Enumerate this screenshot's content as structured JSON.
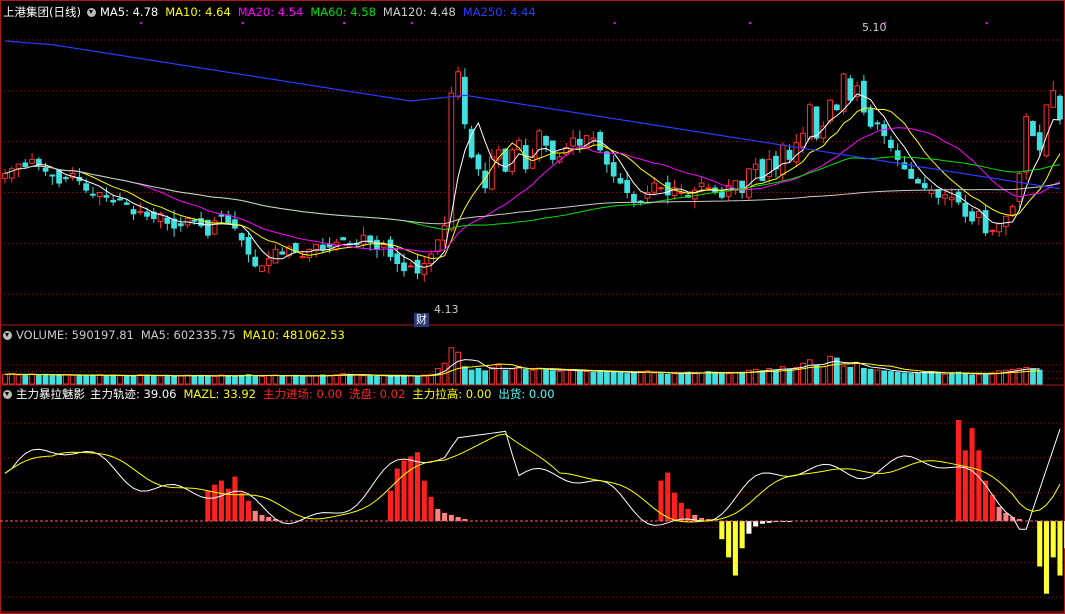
{
  "header_main": {
    "title": "上港集团(日线)",
    "items": [
      {
        "name": "MA5",
        "value": "4.78",
        "color": "#ffffff"
      },
      {
        "name": "MA10",
        "value": "4.64",
        "color": "#ffff00"
      },
      {
        "name": "MA20",
        "value": "4.54",
        "color": "#ff00ff"
      },
      {
        "name": "MA60",
        "value": "4.58",
        "color": "#00e000"
      },
      {
        "name": "MA120",
        "value": "4.48",
        "color": "#cccccc"
      },
      {
        "name": "MA250",
        "value": "4.44",
        "color": "#2b3bff"
      }
    ]
  },
  "header_volume": {
    "items": [
      {
        "name": "VOLUME",
        "value": "590197.81",
        "color": "#cccccc"
      },
      {
        "name": "MA5",
        "value": "602335.75",
        "color": "#cccccc"
      },
      {
        "name": "MA10",
        "value": "481062.53",
        "color": "#ffff00"
      }
    ]
  },
  "header_indicator": {
    "title": "主力暴拉魅影",
    "items": [
      {
        "name": "主力轨迹",
        "value": "39.06",
        "color": "#ffffff"
      },
      {
        "name": "MAZL",
        "value": "33.92",
        "color": "#ffff00"
      },
      {
        "name": "主力进场",
        "value": "0.00",
        "color": "#ff2020"
      },
      {
        "name": "洗盘",
        "value": "0.02",
        "color": "#ff2020"
      },
      {
        "name": "主力拉高",
        "value": "0.00",
        "color": "#ffff00"
      },
      {
        "name": "出货",
        "value": "0.00",
        "color": "#55ffff"
      }
    ]
  },
  "annotations": {
    "high_label": "5.10",
    "low_label": "4.13",
    "fin_marker": "财"
  },
  "colors": {
    "up": "#ff3030",
    "down": "#40e0e0",
    "grid": "#8a1010"
  },
  "chart_data": [
    {
      "type": "candlestick",
      "panel": "price",
      "ylim": [
        3.95,
        5.2
      ],
      "series": [
        {
          "name": "MA5",
          "value": "4.78"
        },
        {
          "name": "MA10",
          "value": "4.64"
        },
        {
          "name": "MA20",
          "value": "4.54"
        },
        {
          "name": "MA60",
          "value": "4.58"
        },
        {
          "name": "MA120",
          "value": "4.48"
        },
        {
          "name": "MA250",
          "value": "4.44"
        }
      ],
      "close": [
        4.56,
        4.58,
        4.6,
        4.59,
        4.62,
        4.6,
        4.57,
        4.55,
        4.52,
        4.54,
        4.56,
        4.53,
        4.49,
        4.47,
        4.48,
        4.46,
        4.44,
        4.45,
        4.43,
        4.39,
        4.4,
        4.38,
        4.37,
        4.39,
        4.35,
        4.33,
        4.34,
        4.37,
        4.36,
        4.34,
        4.3,
        4.36,
        4.38,
        4.35,
        4.33,
        4.28,
        4.22,
        4.17,
        4.17,
        4.2,
        4.24,
        4.22,
        4.25,
        4.23,
        4.21,
        4.24,
        4.26,
        4.24,
        4.25,
        4.27,
        4.28,
        4.26,
        4.26,
        4.3,
        4.27,
        4.24,
        4.26,
        4.21,
        4.18,
        4.15,
        4.17,
        4.14,
        4.18,
        4.22,
        4.28,
        4.34,
        4.9,
        4.99,
        4.77,
        4.63,
        4.58,
        4.5,
        4.63,
        4.66,
        4.57,
        4.66,
        4.7,
        4.58,
        4.63,
        4.74,
        4.68,
        4.62,
        4.63,
        4.67,
        4.71,
        4.68,
        4.72,
        4.71,
        4.66,
        4.6,
        4.55,
        4.52,
        4.48,
        4.44,
        4.44,
        4.48,
        4.52,
        4.5,
        4.47,
        4.5,
        4.48,
        4.46,
        4.49,
        4.52,
        4.5,
        4.48,
        4.46,
        4.51,
        4.53,
        4.48,
        4.58,
        4.6,
        4.53,
        4.62,
        4.58,
        4.68,
        4.62,
        4.69,
        4.73,
        4.85,
        4.71,
        4.76,
        4.87,
        4.83,
        4.98,
        4.87,
        4.93,
        4.82,
        4.76,
        4.77,
        4.72,
        4.67,
        4.62,
        4.58,
        4.54,
        4.52,
        4.5,
        4.49,
        4.46,
        4.47,
        4.46,
        4.44,
        4.38,
        4.36,
        4.4,
        4.31,
        4.32,
        4.35,
        4.38,
        4.42,
        4.56,
        4.8,
        4.72,
        4.66,
        4.85,
        4.91,
        4.79
      ],
      "volume": [
        28,
        30,
        26,
        27,
        29,
        25,
        28,
        24,
        26,
        27,
        25,
        26,
        24,
        25,
        27,
        23,
        26,
        24,
        22,
        25,
        27,
        26,
        24,
        23,
        25,
        22,
        24,
        26,
        23,
        25,
        24,
        22,
        26,
        24,
        23,
        25,
        27,
        24,
        22,
        25,
        26,
        23,
        24,
        25,
        22,
        23,
        24,
        26,
        25,
        27,
        30,
        28,
        26,
        24,
        25,
        23,
        24,
        22,
        23,
        25,
        24,
        22,
        26,
        28,
        45,
        60,
        105,
        92,
        50,
        40,
        45,
        38,
        48,
        55,
        40,
        44,
        50,
        42,
        40,
        46,
        42,
        38,
        36,
        40,
        42,
        38,
        36,
        34,
        38,
        36,
        35,
        32,
        30,
        34,
        36,
        38,
        32,
        30,
        28,
        30,
        32,
        34,
        30,
        32,
        36,
        34,
        32,
        30,
        32,
        34,
        40,
        42,
        38,
        45,
        40,
        50,
        44,
        48,
        60,
        70,
        55,
        50,
        80,
        75,
        52,
        48,
        60,
        45,
        42,
        40,
        38,
        36,
        34,
        32,
        30,
        32,
        34,
        36,
        30,
        28,
        32,
        34,
        30,
        26,
        28,
        30,
        32,
        38,
        40,
        42,
        45,
        48,
        44,
        40
      ]
    },
    {
      "type": "line",
      "panel": "indicator",
      "ylim": [
        -10,
        110
      ],
      "series": [
        {
          "name": "主力轨迹",
          "value": "39.06"
        },
        {
          "name": "MAZL",
          "value": "33.92"
        }
      ],
      "bars": [
        {
          "name": "主力进场",
          "value": "0.00"
        },
        {
          "name": "洗盘",
          "value": "0.02"
        },
        {
          "name": "主力拉高",
          "value": "0.00"
        },
        {
          "name": "出货",
          "value": "0.00"
        }
      ]
    }
  ]
}
